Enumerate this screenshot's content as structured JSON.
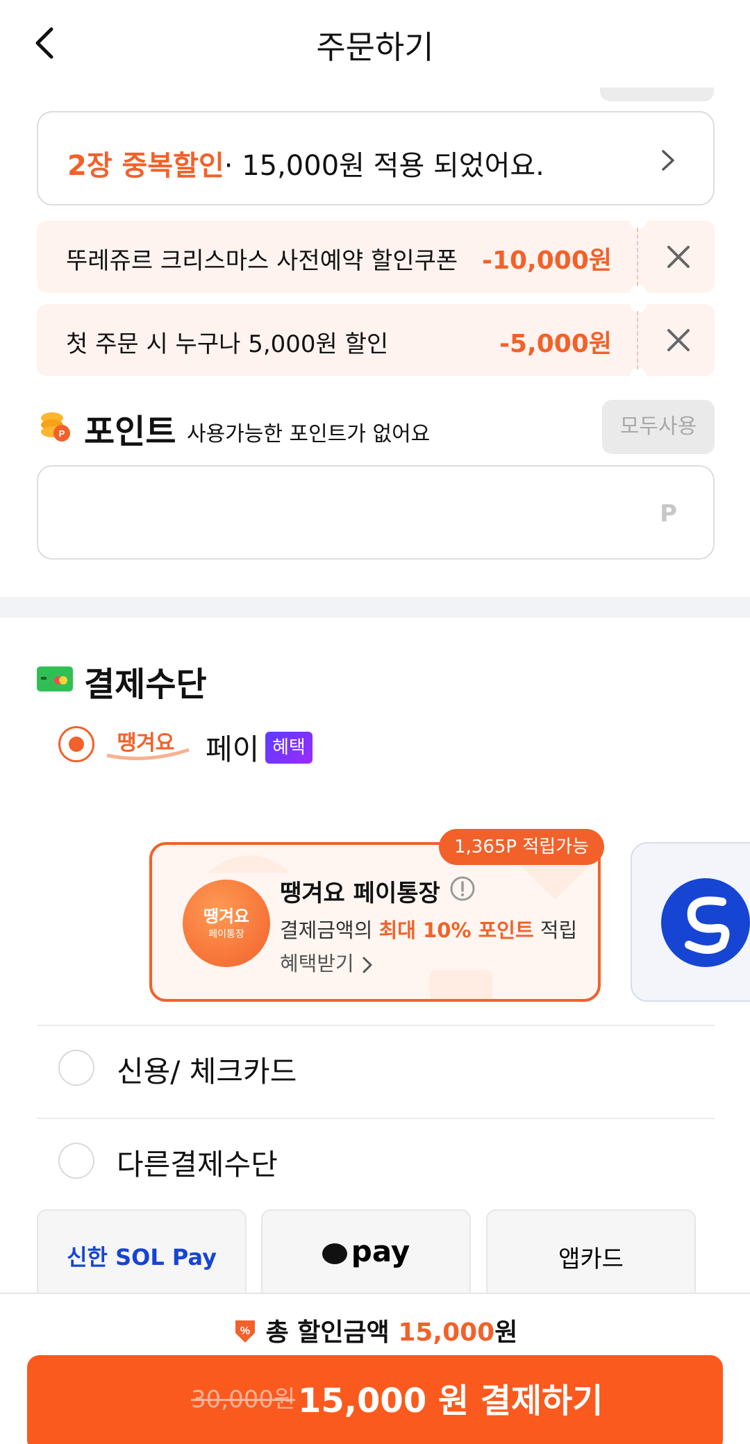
{
  "header": {
    "title": "주문하기"
  },
  "coupon_summary": {
    "highlight": "2장 중복할인",
    "text": "· 15,000원 적용 되었어요."
  },
  "coupons": [
    {
      "name": "뚜레쥬르 크리스마스 사전예약 할인쿠폰",
      "amount": "-10,000원"
    },
    {
      "name": "첫 주문 시 누구나 5,000원 할인",
      "amount": "-5,000원"
    }
  ],
  "points": {
    "title": "포인트",
    "subtitle": "사용가능한 포인트가 없어요",
    "use_all": "모두사용",
    "unit": "P"
  },
  "payment": {
    "title": "결제수단",
    "main_option": {
      "brand": "땡겨요",
      "label": "페이",
      "badge": "혜택"
    },
    "card": {
      "reward": "1,365P 적립가능",
      "logo_text": "땡겨요",
      "logo_sub": "페이통장",
      "name": "땡겨요 페이통장",
      "desc_prefix": "결제금액의 ",
      "desc_highlight": "최대 10% 포인트",
      "desc_suffix": " 적립",
      "link": "혜택받기"
    },
    "options": [
      "신용/ 체크카드",
      "다른결제수단"
    ],
    "methods": [
      "신한 SOL Pay",
      "pay",
      "앱카드"
    ]
  },
  "bottom": {
    "discount_label": "총 할인금액 ",
    "discount_amount": "15,000",
    "discount_unit": "원",
    "original_price": "30,000원",
    "pay_label": "15,000 원 결제하기"
  },
  "colors": {
    "accent": "#f2612a",
    "button": "#fb5a1f",
    "badge": "#7a33ff",
    "bank": "#1645d4"
  }
}
